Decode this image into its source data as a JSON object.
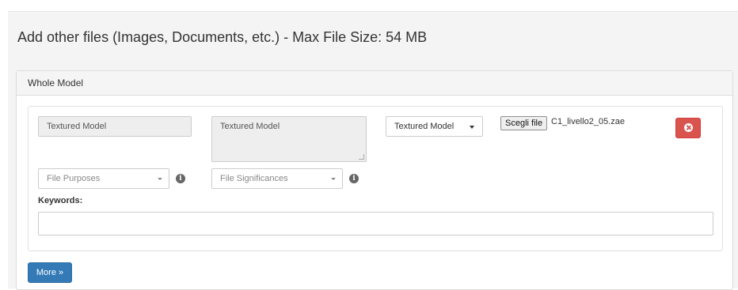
{
  "page": {
    "title": "Add other files (Images, Documents, etc.) - Max File Size: 54 MB"
  },
  "panel": {
    "heading": "Whole Model"
  },
  "file_entry": {
    "title_value": "Textured Model",
    "description_value": "Textured Model",
    "type_select": {
      "selected": "Textured Model"
    },
    "file_chooser": {
      "button_label": "Scegli file",
      "file_name": "C1_livello2_05.zae"
    },
    "purposes": {
      "placeholder": "File Purposes"
    },
    "significances": {
      "placeholder": "File Significances"
    },
    "keywords": {
      "label": "Keywords:",
      "value": ""
    },
    "colors": {
      "remove": "#d9534f",
      "more": "#337ab7"
    },
    "icons": {
      "remove": "times-circle-icon",
      "info": "info-circle-icon",
      "dropdown": "caret-down-icon"
    }
  },
  "actions": {
    "more_label": "More »"
  }
}
